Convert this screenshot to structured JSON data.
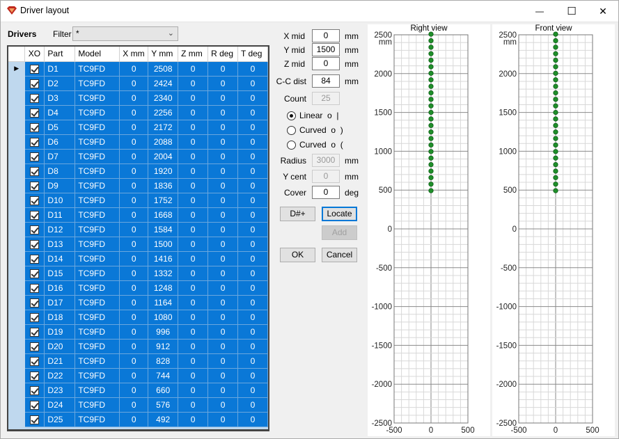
{
  "window": {
    "title": "Driver layout",
    "controls": {
      "minimize": "—",
      "maximize": "☐",
      "close": "✕"
    }
  },
  "drivers": {
    "label": "Drivers",
    "filter_label": "Filter",
    "filter_value": "*",
    "columns": [
      "XO",
      "Part",
      "Model",
      "X mm",
      "Y mm",
      "Z mm",
      "R deg",
      "T deg"
    ],
    "rows": [
      {
        "xo": true,
        "part": "D1",
        "model": "TC9FD",
        "x": "0",
        "y": "2508",
        "z": "0",
        "r": "0",
        "t": "0"
      },
      {
        "xo": true,
        "part": "D2",
        "model": "TC9FD",
        "x": "0",
        "y": "2424",
        "z": "0",
        "r": "0",
        "t": "0"
      },
      {
        "xo": true,
        "part": "D3",
        "model": "TC9FD",
        "x": "0",
        "y": "2340",
        "z": "0",
        "r": "0",
        "t": "0"
      },
      {
        "xo": true,
        "part": "D4",
        "model": "TC9FD",
        "x": "0",
        "y": "2256",
        "z": "0",
        "r": "0",
        "t": "0"
      },
      {
        "xo": true,
        "part": "D5",
        "model": "TC9FD",
        "x": "0",
        "y": "2172",
        "z": "0",
        "r": "0",
        "t": "0"
      },
      {
        "xo": true,
        "part": "D6",
        "model": "TC9FD",
        "x": "0",
        "y": "2088",
        "z": "0",
        "r": "0",
        "t": "0"
      },
      {
        "xo": true,
        "part": "D7",
        "model": "TC9FD",
        "x": "0",
        "y": "2004",
        "z": "0",
        "r": "0",
        "t": "0"
      },
      {
        "xo": true,
        "part": "D8",
        "model": "TC9FD",
        "x": "0",
        "y": "1920",
        "z": "0",
        "r": "0",
        "t": "0"
      },
      {
        "xo": true,
        "part": "D9",
        "model": "TC9FD",
        "x": "0",
        "y": "1836",
        "z": "0",
        "r": "0",
        "t": "0"
      },
      {
        "xo": true,
        "part": "D10",
        "model": "TC9FD",
        "x": "0",
        "y": "1752",
        "z": "0",
        "r": "0",
        "t": "0"
      },
      {
        "xo": true,
        "part": "D11",
        "model": "TC9FD",
        "x": "0",
        "y": "1668",
        "z": "0",
        "r": "0",
        "t": "0"
      },
      {
        "xo": true,
        "part": "D12",
        "model": "TC9FD",
        "x": "0",
        "y": "1584",
        "z": "0",
        "r": "0",
        "t": "0"
      },
      {
        "xo": true,
        "part": "D13",
        "model": "TC9FD",
        "x": "0",
        "y": "1500",
        "z": "0",
        "r": "0",
        "t": "0"
      },
      {
        "xo": true,
        "part": "D14",
        "model": "TC9FD",
        "x": "0",
        "y": "1416",
        "z": "0",
        "r": "0",
        "t": "0"
      },
      {
        "xo": true,
        "part": "D15",
        "model": "TC9FD",
        "x": "0",
        "y": "1332",
        "z": "0",
        "r": "0",
        "t": "0"
      },
      {
        "xo": true,
        "part": "D16",
        "model": "TC9FD",
        "x": "0",
        "y": "1248",
        "z": "0",
        "r": "0",
        "t": "0"
      },
      {
        "xo": true,
        "part": "D17",
        "model": "TC9FD",
        "x": "0",
        "y": "1164",
        "z": "0",
        "r": "0",
        "t": "0"
      },
      {
        "xo": true,
        "part": "D18",
        "model": "TC9FD",
        "x": "0",
        "y": "1080",
        "z": "0",
        "r": "0",
        "t": "0"
      },
      {
        "xo": true,
        "part": "D19",
        "model": "TC9FD",
        "x": "0",
        "y": "996",
        "z": "0",
        "r": "0",
        "t": "0"
      },
      {
        "xo": true,
        "part": "D20",
        "model": "TC9FD",
        "x": "0",
        "y": "912",
        "z": "0",
        "r": "0",
        "t": "0"
      },
      {
        "xo": true,
        "part": "D21",
        "model": "TC9FD",
        "x": "0",
        "y": "828",
        "z": "0",
        "r": "0",
        "t": "0"
      },
      {
        "xo": true,
        "part": "D22",
        "model": "TC9FD",
        "x": "0",
        "y": "744",
        "z": "0",
        "r": "0",
        "t": "0"
      },
      {
        "xo": true,
        "part": "D23",
        "model": "TC9FD",
        "x": "0",
        "y": "660",
        "z": "0",
        "r": "0",
        "t": "0"
      },
      {
        "xo": true,
        "part": "D24",
        "model": "TC9FD",
        "x": "0",
        "y": "576",
        "z": "0",
        "r": "0",
        "t": "0"
      },
      {
        "xo": true,
        "part": "D25",
        "model": "TC9FD",
        "x": "0",
        "y": "492",
        "z": "0",
        "r": "0",
        "t": "0"
      }
    ],
    "current_row_marker": "▶"
  },
  "params": {
    "x_mid": {
      "label": "X mid",
      "value": "0",
      "unit": "mm"
    },
    "y_mid": {
      "label": "Y mid",
      "value": "1500",
      "unit": "mm"
    },
    "z_mid": {
      "label": "Z mid",
      "value": "0",
      "unit": "mm"
    },
    "cc_dist": {
      "label": "C-C dist",
      "value": "84",
      "unit": "mm"
    },
    "count": {
      "label": "Count",
      "value": "25"
    },
    "layout_options": [
      {
        "label": "Linear  o  |",
        "selected": true
      },
      {
        "label": "Curved  o  )",
        "selected": false
      },
      {
        "label": "Curved  o  (",
        "selected": false
      }
    ],
    "radius": {
      "label": "Radius",
      "value": "3000",
      "unit": "mm"
    },
    "y_cent": {
      "label": "Y cent",
      "value": "0",
      "unit": "mm"
    },
    "cover": {
      "label": "Cover",
      "value": "0",
      "unit": "deg"
    }
  },
  "buttons": {
    "dnum": "D#+",
    "locate": "Locate",
    "add": "Add",
    "ok": "OK",
    "cancel": "Cancel"
  },
  "colors": {
    "selection": "#0a78d7",
    "point_fill": "#1f8f2a",
    "point_stroke": "#0d5c16"
  },
  "chart_data": [
    {
      "type": "scatter",
      "title": "Right view",
      "ylabel": "mm",
      "xlim": [
        -500,
        500
      ],
      "ylim": [
        -2500,
        2500
      ],
      "x_ticks": [
        "-500",
        "0",
        "500"
      ],
      "y_ticks": [
        "2500",
        "2000",
        "1500",
        "1000",
        "500",
        "0",
        "-500",
        "-1000",
        "-1500",
        "-2000",
        "-2500"
      ],
      "grid": true,
      "x": [
        0,
        0,
        0,
        0,
        0,
        0,
        0,
        0,
        0,
        0,
        0,
        0,
        0,
        0,
        0,
        0,
        0,
        0,
        0,
        0,
        0,
        0,
        0,
        0,
        0
      ],
      "y": [
        2508,
        2424,
        2340,
        2256,
        2172,
        2088,
        2004,
        1920,
        1836,
        1752,
        1668,
        1584,
        1500,
        1416,
        1332,
        1248,
        1164,
        1080,
        996,
        912,
        828,
        744,
        660,
        576,
        492
      ]
    },
    {
      "type": "scatter",
      "title": "Front view",
      "ylabel": "mm",
      "xlim": [
        -500,
        500
      ],
      "ylim": [
        -2500,
        2500
      ],
      "x_ticks": [
        "-500",
        "0",
        "500"
      ],
      "y_ticks": [
        "2500",
        "2000",
        "1500",
        "1000",
        "500",
        "0",
        "-500",
        "-1000",
        "-1500",
        "-2000",
        "-2500"
      ],
      "grid": true,
      "x": [
        0,
        0,
        0,
        0,
        0,
        0,
        0,
        0,
        0,
        0,
        0,
        0,
        0,
        0,
        0,
        0,
        0,
        0,
        0,
        0,
        0,
        0,
        0,
        0,
        0
      ],
      "y": [
        2508,
        2424,
        2340,
        2256,
        2172,
        2088,
        2004,
        1920,
        1836,
        1752,
        1668,
        1584,
        1500,
        1416,
        1332,
        1248,
        1164,
        1080,
        996,
        912,
        828,
        744,
        660,
        576,
        492
      ]
    }
  ]
}
